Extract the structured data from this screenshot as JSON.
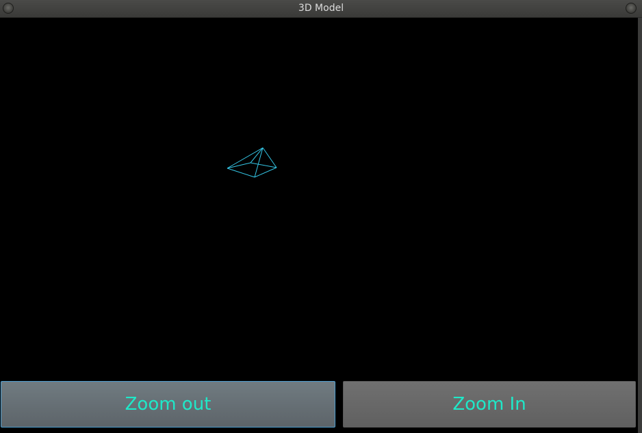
{
  "window": {
    "title": "3D Model"
  },
  "viewport": {
    "model": "pyramid",
    "line_color": "#35c8e8",
    "background_color": "#000000"
  },
  "buttons": {
    "zoom_out_label": "Zoom out",
    "zoom_in_label": "Zoom In",
    "label_color": "#1fe8c8"
  }
}
